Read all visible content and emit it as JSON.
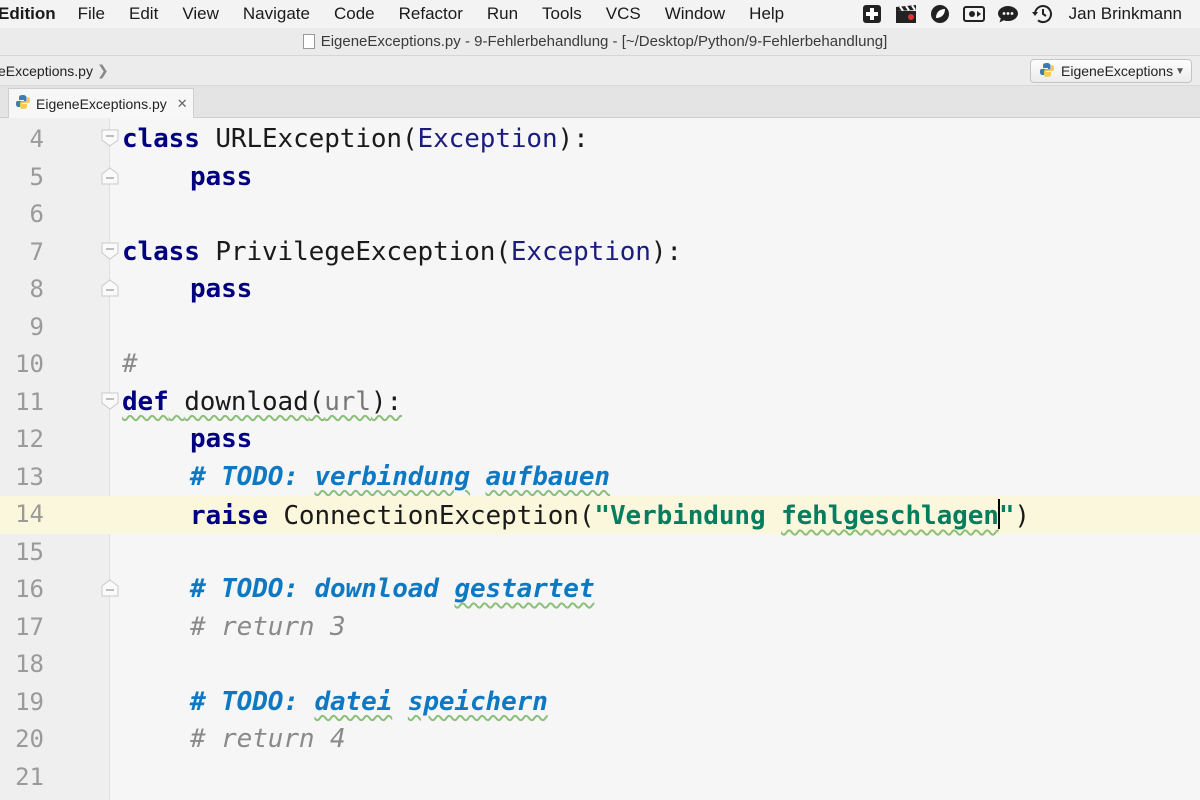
{
  "menubar": {
    "app_name": "Edition",
    "items": [
      "File",
      "Edit",
      "View",
      "Navigate",
      "Code",
      "Refactor",
      "Run",
      "Tools",
      "VCS",
      "Window",
      "Help"
    ],
    "user_name": "Jan Brinkmann",
    "tray_icons": [
      "medical-cross-icon",
      "clapperboard-icon",
      "circle-leaf-icon",
      "screen-record-icon",
      "chat-bubble-icon",
      "time-machine-icon"
    ]
  },
  "titlebar": {
    "title": "EigeneExceptions.py - 9-Fehlerbehandlung - [~/Desktop/Python/9-Fehlerbehandlung]"
  },
  "navbar": {
    "breadcrumb": "eExceptions.py",
    "run_config": "EigeneExceptions"
  },
  "tabs": [
    {
      "label": "EigeneExceptions.py",
      "active": true
    }
  ],
  "editor": {
    "current_line": 14,
    "lines": [
      {
        "n": "4"
      },
      {
        "n": "5"
      },
      {
        "n": "6"
      },
      {
        "n": "7"
      },
      {
        "n": "8"
      },
      {
        "n": "9"
      },
      {
        "n": "10"
      },
      {
        "n": "11"
      },
      {
        "n": "12"
      },
      {
        "n": "13"
      },
      {
        "n": "14"
      },
      {
        "n": "15"
      },
      {
        "n": "16"
      },
      {
        "n": "17"
      },
      {
        "n": "18"
      },
      {
        "n": "19"
      },
      {
        "n": "20"
      },
      {
        "n": "21"
      }
    ],
    "tokens": {
      "l4_kw": "class",
      "l4_name": "URLException",
      "l4_open": "(",
      "l4_base": "Exception",
      "l4_close": "):",
      "l5_kw": "pass",
      "l7_kw": "class",
      "l7_name": "PrivilegeException",
      "l7_open": "(",
      "l7_base": "Exception",
      "l7_close": "):",
      "l8_kw": "pass",
      "l10_comment": "#",
      "l11_kw": "def",
      "l11_name": "download",
      "l11_open": "(",
      "l11_param": "url",
      "l11_close": "):",
      "l12_kw": "pass",
      "l13_hash": "# ",
      "l13_todo": "TODO: ",
      "l13_w1": "verbindung",
      "l13_w2": "aufbauen",
      "l14_kw": "raise",
      "l14_name": "ConnectionException",
      "l14_open": "(",
      "l14_str_a": "\"Verbindung ",
      "l14_str_b": "fehlgeschlagen",
      "l14_str_end": "\"",
      "l14_close": ")",
      "l16_hash": "# ",
      "l16_todo": "TODO: ",
      "l16_w1": "download",
      "l16_w2": "gestartet",
      "l17_comment": "# return 3",
      "l19_hash": "# ",
      "l19_todo": "TODO: ",
      "l19_w1": "datei",
      "l19_w2": "speichern",
      "l20_comment": "# return 4"
    }
  }
}
